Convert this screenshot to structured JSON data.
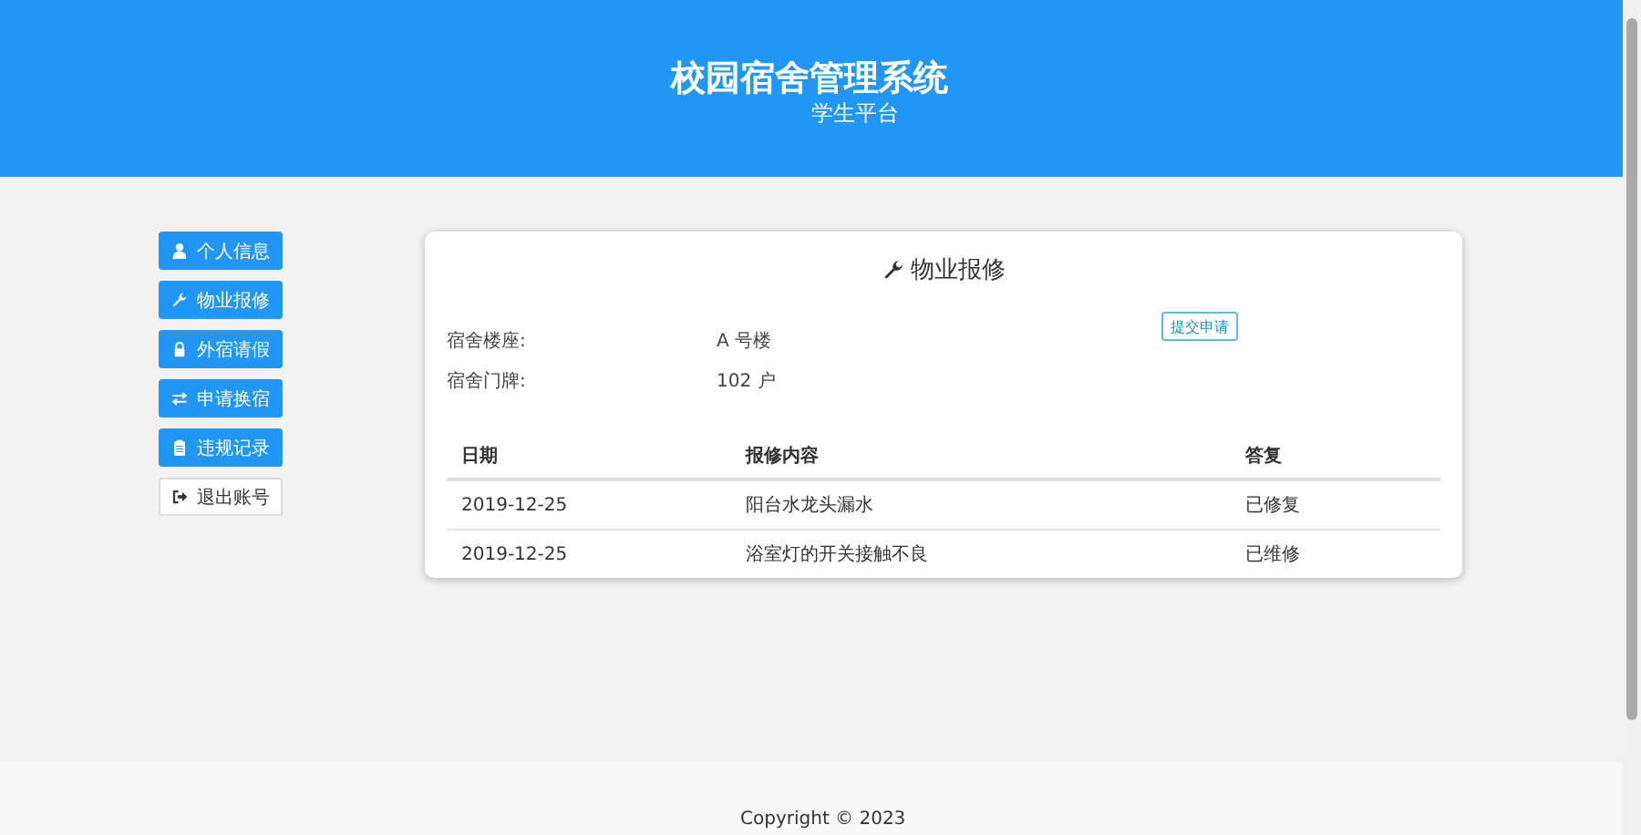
{
  "header": {
    "title": "校园宿舍管理系统",
    "subtitle": "学生平台"
  },
  "sidebar": {
    "items": [
      {
        "label": "个人信息",
        "kind": "primary"
      },
      {
        "label": "物业报修",
        "kind": "primary"
      },
      {
        "label": "外宿请假",
        "kind": "primary"
      },
      {
        "label": "申请换宿",
        "kind": "primary"
      },
      {
        "label": "违规记录",
        "kind": "primary"
      },
      {
        "label": "退出账号",
        "kind": "default"
      }
    ]
  },
  "panel": {
    "title": "物业报修",
    "submit_button": "提交申请",
    "fields": [
      {
        "label": "宿舍楼座:",
        "value": "A 号楼"
      },
      {
        "label": "宿舍门牌:",
        "value": "102 户"
      }
    ],
    "table": {
      "columns": [
        "日期",
        "报修内容",
        "答复"
      ],
      "rows": [
        [
          "2019-12-25",
          "阳台水龙头漏水",
          "已修复"
        ],
        [
          "2019-12-25",
          "浴室灯的开关接触不良",
          "已维修"
        ]
      ]
    }
  },
  "footer": {
    "copyright": "Copyright © 2023"
  }
}
